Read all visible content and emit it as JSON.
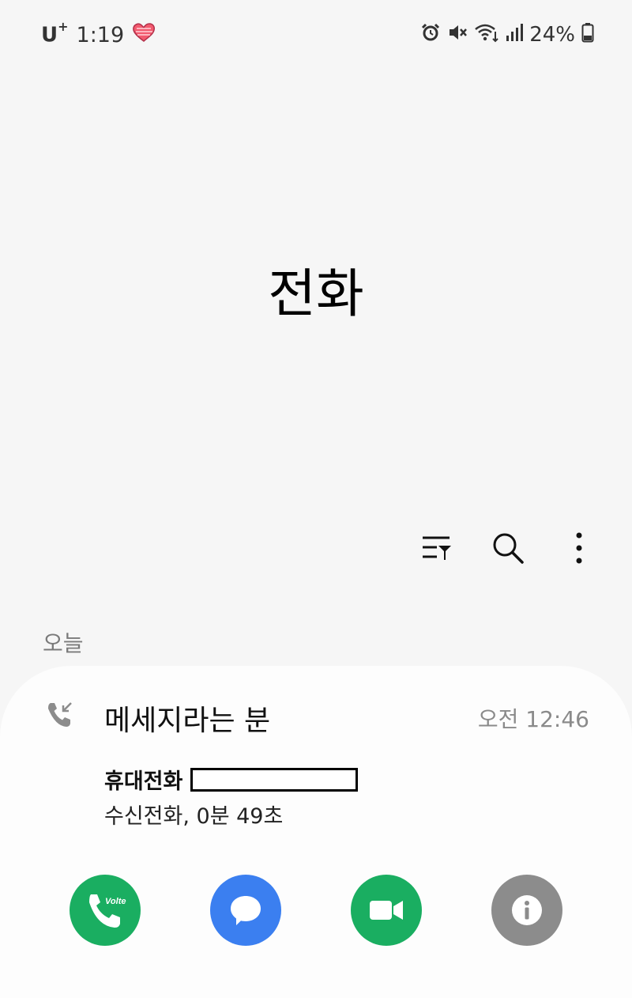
{
  "status_bar": {
    "carrier": "U",
    "carrier_sup": "+",
    "time": "1:19",
    "battery": "24%"
  },
  "header": {
    "title": "전화"
  },
  "section": {
    "label": "오늘"
  },
  "call_log": [
    {
      "name": "메세지라는 분",
      "time": "오전 12:46",
      "number_type": "휴대전화",
      "detail": "수신전화, 0분 49초"
    }
  ],
  "actions": [
    {
      "name": "call-button",
      "icon": "phone-volte-icon",
      "color": "#1aae61"
    },
    {
      "name": "message-button",
      "icon": "chat-bubble-icon",
      "color": "#3b7ff0"
    },
    {
      "name": "video-call-button",
      "icon": "video-camera-icon",
      "color": "#1aae61"
    },
    {
      "name": "details-button",
      "icon": "info-icon",
      "color": "#8c8c8c"
    }
  ],
  "colors": {
    "background": "#f6f6f6",
    "card": "#fdfdfd",
    "green": "#1aae61",
    "blue": "#3b7ff0",
    "gray": "#8c8c8c"
  }
}
